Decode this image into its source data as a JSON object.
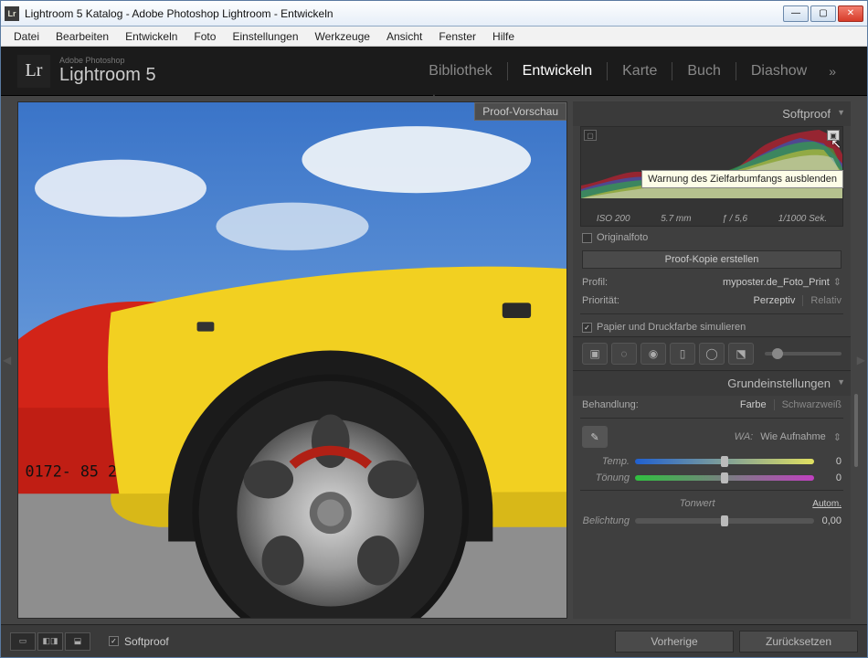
{
  "window": {
    "title": "Lightroom 5 Katalog - Adobe Photoshop Lightroom - Entwickeln"
  },
  "menu": {
    "items": [
      "Datei",
      "Bearbeiten",
      "Entwickeln",
      "Foto",
      "Einstellungen",
      "Werkzeuge",
      "Ansicht",
      "Fenster",
      "Hilfe"
    ]
  },
  "brand": {
    "small": "Adobe Photoshop",
    "large": "Lightroom 5",
    "icon_text": "Lr"
  },
  "modules": {
    "items": [
      "Bibliothek",
      "Entwickeln",
      "Karte",
      "Buch",
      "Diashow"
    ],
    "active_index": 1,
    "more": "»"
  },
  "preview": {
    "proof_label": "Proof-Vorschau"
  },
  "tooltip": "Warnung des Zielfarbumfangs ausblenden",
  "softproof_panel": {
    "title": "Softproof",
    "exif": {
      "iso": "ISO 200",
      "focal": "5.7 mm",
      "aperture": "ƒ / 5,6",
      "shutter": "1/1000 Sek."
    },
    "originalfoto_label": "Originalfoto",
    "create_copy_btn": "Proof-Kopie erstellen",
    "profile_label": "Profil:",
    "profile_value": "myposter.de_Foto_Print",
    "priority_label": "Priorität:",
    "priority_perzeptiv": "Perzeptiv",
    "priority_relativ": "Relativ",
    "simulate_label": "Papier und Druckfarbe simulieren"
  },
  "basic_panel": {
    "title": "Grundeinstellungen",
    "treatment_label": "Behandlung:",
    "treatment_color": "Farbe",
    "treatment_bw": "Schwarzweiß",
    "wb_label": "WA:",
    "wb_value": "Wie Aufnahme",
    "temp_label": "Temp.",
    "temp_value": "0",
    "tint_label": "Tönung",
    "tint_value": "0",
    "tone_section": "Tonwert",
    "auto_label": "Autom.",
    "exposure_label": "Belichtung",
    "exposure_value": "0,00"
  },
  "bottom": {
    "softproof_label": "Softproof",
    "prev_btn": "Vorherige",
    "reset_btn": "Zurücksetzen"
  }
}
